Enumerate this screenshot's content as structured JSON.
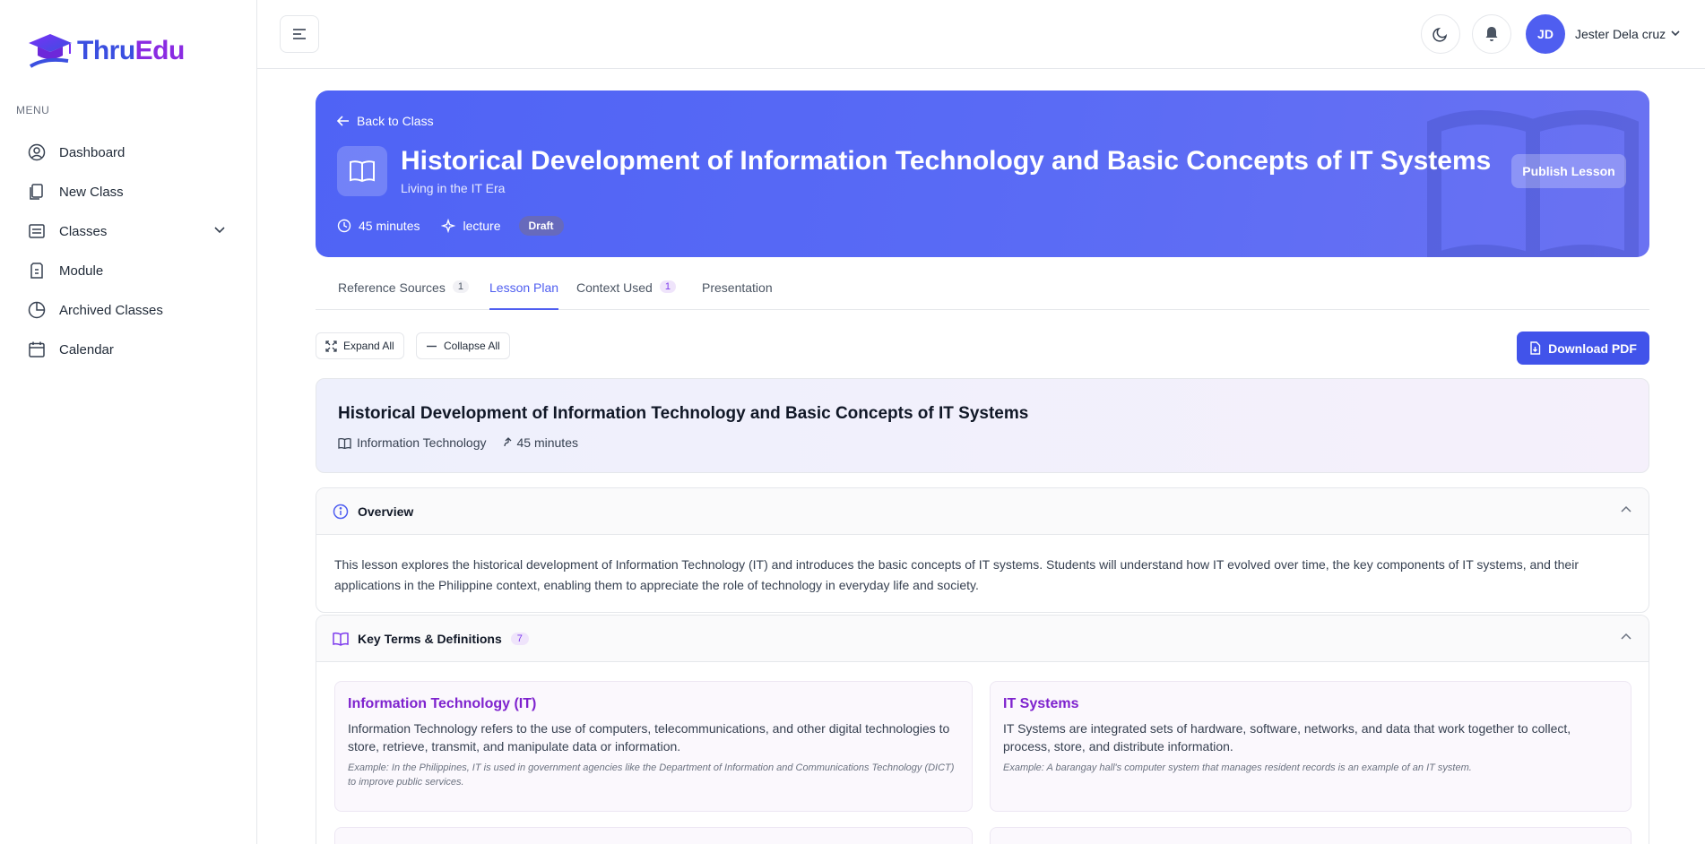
{
  "brand": {
    "part1": "Thru",
    "part2": "Edu"
  },
  "sidebar": {
    "menu_label": "MENU",
    "items": [
      {
        "label": "Dashboard",
        "icon": "user-circle-icon"
      },
      {
        "label": "New Class",
        "icon": "copy-icon"
      },
      {
        "label": "Classes",
        "icon": "list-icon"
      },
      {
        "label": "Module",
        "icon": "file-icon"
      },
      {
        "label": "Archived Classes",
        "icon": "pie-chart-icon"
      },
      {
        "label": "Calendar",
        "icon": "calendar-icon"
      }
    ]
  },
  "topbar": {
    "avatar_initials": "JD",
    "user_name": "Jester Dela cruz"
  },
  "hero": {
    "back_label": "Back to Class",
    "title": "Historical Development of Information Technology and Basic Concepts of IT Systems",
    "subtitle": "Living in the IT Era",
    "duration": "45 minutes",
    "type": "lecture",
    "status": "Draft",
    "publish_label": "Publish Lesson"
  },
  "tabs": [
    {
      "label": "Reference Sources",
      "count": "1"
    },
    {
      "label": "Lesson Plan",
      "count": ""
    },
    {
      "label": "Context Used",
      "count": "1"
    },
    {
      "label": "Presentation",
      "count": ""
    }
  ],
  "toolbar": {
    "expand_label": "Expand All",
    "collapse_label": "Collapse All",
    "pdf_label": "Download PDF"
  },
  "lesson": {
    "title": "Historical Development of Information Technology and Basic Concepts of IT Systems",
    "subject": "Information Technology",
    "duration": "45 minutes"
  },
  "overview": {
    "heading": "Overview",
    "text": "This lesson explores the historical development of Information Technology (IT) and introduces the basic concepts of IT systems. Students will understand how IT evolved over time, the key components of IT systems, and their applications in the Philippine context, enabling them to appreciate the role of technology in everyday life and society."
  },
  "key_terms": {
    "heading": "Key Terms & Definitions",
    "count": "7",
    "terms": [
      {
        "title": "Information Technology (IT)",
        "definition": "Information Technology refers to the use of computers, telecommunications, and other digital technologies to store, retrieve, transmit, and manipulate data or information.",
        "example": "Example: In the Philippines, IT is used in government agencies like the Department of Information and Communications Technology (DICT) to improve public services."
      },
      {
        "title": "IT Systems",
        "definition": "IT Systems are integrated sets of hardware, software, networks, and data that work together to collect, process, store, and distribute information.",
        "example": "Example: A barangay hall's computer system that manages resident records is an example of an IT system."
      }
    ]
  },
  "colors": {
    "primary": "#4f5ef0",
    "accent_purple": "#7e22ce",
    "hero_start": "#4f63f5"
  }
}
